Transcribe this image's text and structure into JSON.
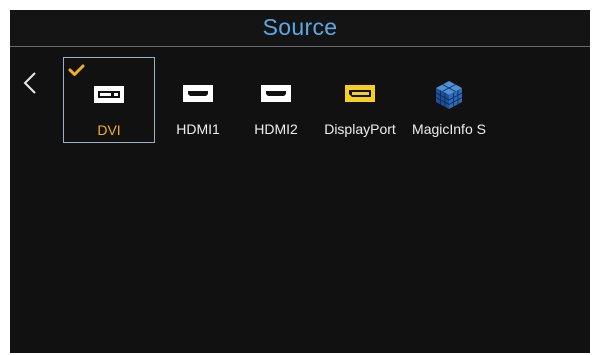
{
  "header": {
    "title": "Source"
  },
  "navigation": {
    "back_icon": "chevron-left-icon"
  },
  "sources": [
    {
      "label": "DVI",
      "icon": "dvi-port-icon",
      "selected": true
    },
    {
      "label": "HDMI1",
      "icon": "hdmi-port-icon",
      "selected": false
    },
    {
      "label": "HDMI2",
      "icon": "hdmi-port-icon",
      "selected": false
    },
    {
      "label": "DisplayPort",
      "icon": "displayport-port-icon",
      "selected": false
    },
    {
      "label": "MagicInfo S",
      "icon": "magicinfo-cube-icon",
      "selected": false
    }
  ],
  "colors": {
    "title": "#5aa9e6",
    "selected_label": "#f2b01e",
    "check": "#f2b01e",
    "background": "#111111"
  }
}
